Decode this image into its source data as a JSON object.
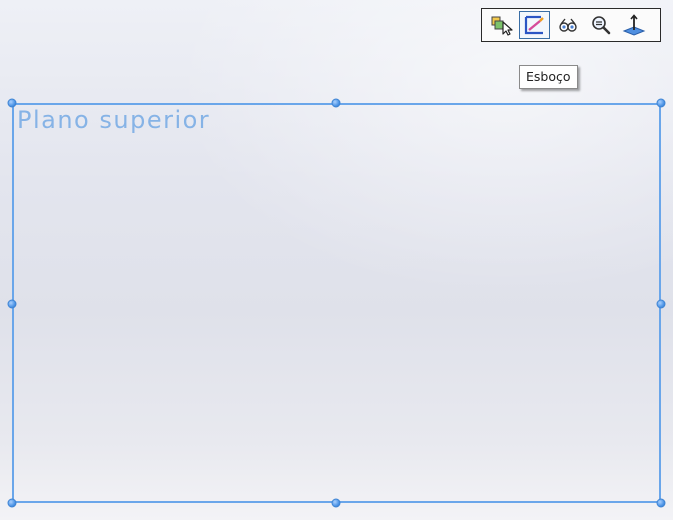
{
  "toolbar": {
    "items": [
      {
        "icon": "select-other-icon"
      },
      {
        "icon": "sketch-icon",
        "active": true
      },
      {
        "icon": "view-icon"
      },
      {
        "icon": "zoom-icon"
      },
      {
        "icon": "normal-to-icon"
      }
    ]
  },
  "tooltip": {
    "text": "Esboço"
  },
  "plane": {
    "label": "Plano superior",
    "color": "#6aa6ea",
    "label_color": "#86b3e6"
  }
}
